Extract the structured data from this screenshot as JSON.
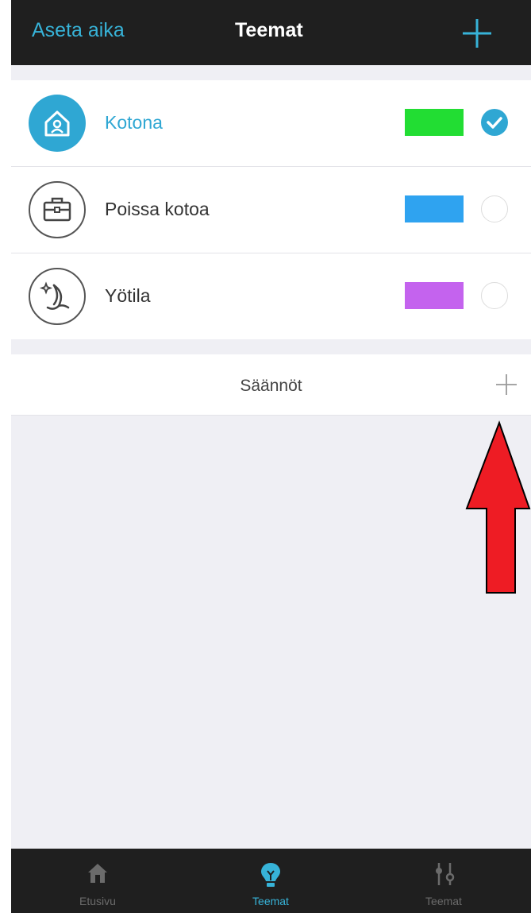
{
  "navbar": {
    "left_label": "Aseta aika",
    "title": "Teemat",
    "add_icon": "plus-icon"
  },
  "themes": [
    {
      "label": "Kotona",
      "icon": "home-icon",
      "color": "#22dd33",
      "selected": true
    },
    {
      "label": "Poissa kotoa",
      "icon": "briefcase-icon",
      "color": "#2fa3f0",
      "selected": false
    },
    {
      "label": "Yötila",
      "icon": "moon-icon",
      "color": "#c463ee",
      "selected": false
    }
  ],
  "rules": {
    "label": "Säännöt",
    "add_icon": "plus-icon"
  },
  "tabbar": {
    "tabs": [
      {
        "label": "Etusivu",
        "icon": "home-icon",
        "active": false
      },
      {
        "label": "Teemat",
        "icon": "lightbulb-icon",
        "active": true
      },
      {
        "label": "Teemat",
        "icon": "sliders-icon",
        "active": false
      }
    ]
  },
  "colors": {
    "accent": "#37b3d8",
    "bar_background": "#1f1f1f",
    "page_background": "#efeff4",
    "annotation_arrow": "#ee1c24"
  }
}
